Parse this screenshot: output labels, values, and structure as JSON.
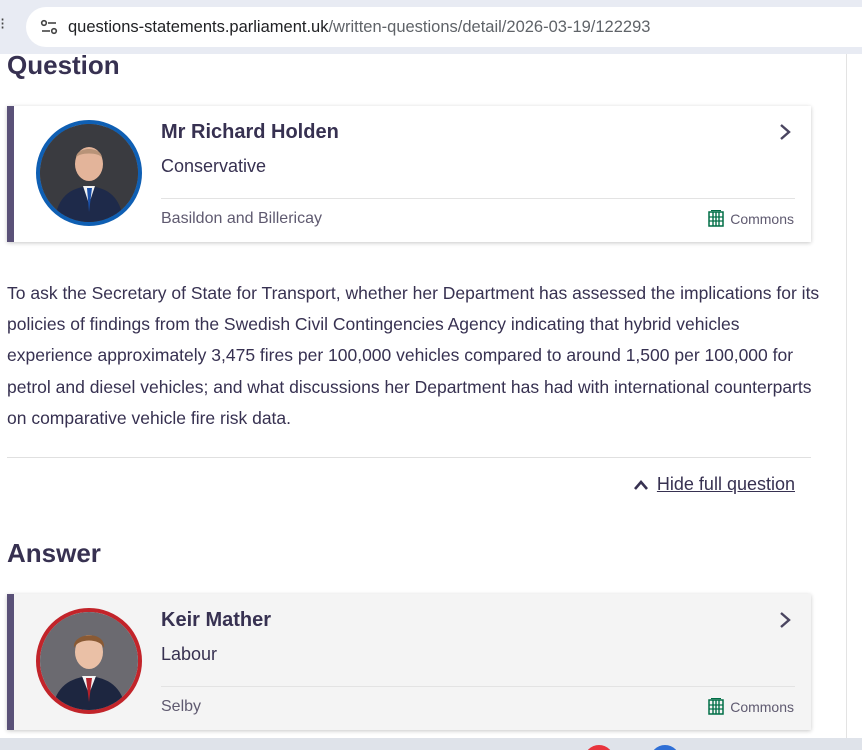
{
  "browser": {
    "url_host": "questions-statements.parliament.uk",
    "url_path": "/written-questions/detail/2026-03-19/122293"
  },
  "question_section": {
    "title": "Question",
    "member": {
      "name": "Mr Richard Holden",
      "party": "Conservative",
      "constituency": "Basildon and Billericay",
      "house": "Commons",
      "portrait_ring_color": "#0f5fb3"
    },
    "text": "To ask the Secretary of State for Transport, whether her Department has assessed the implications for its policies of findings from the Swedish Civil Contingencies Agency indicating that hybrid vehicles experience approximately 3,475 fires per 100,000 vehicles compared to around 1,500 per 100,000 for petrol and diesel vehicles; and what discussions her Department has had with international counterparts on comparative vehicle fire risk data.",
    "toggle_label": "Hide full question"
  },
  "answer_section": {
    "title": "Answer",
    "member": {
      "name": "Keir Mather",
      "party": "Labour",
      "constituency": "Selby",
      "house": "Commons",
      "portrait_ring_color": "#c2242a"
    }
  },
  "colors": {
    "card_accent": "#5a5178",
    "text": "#373151",
    "commons_green": "#006e46"
  }
}
